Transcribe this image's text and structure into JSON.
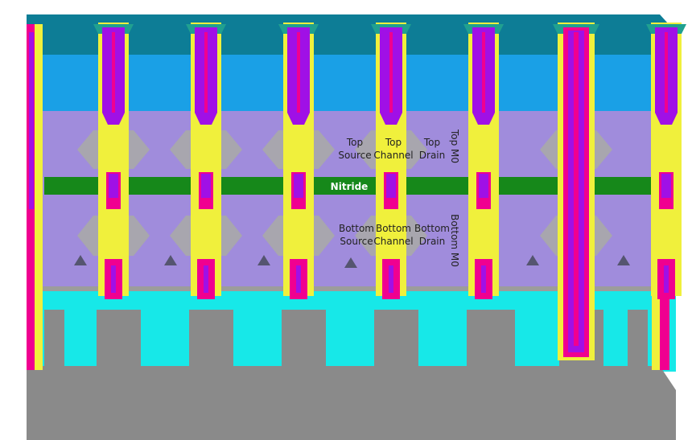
{
  "labels": {
    "top_source": [
      "Top",
      "Source"
    ],
    "top_channel": [
      "Top",
      "Channel"
    ],
    "top_drain": [
      "Top",
      "Drain"
    ],
    "top_m0": "Top M0",
    "nitride": "Nitride",
    "bottom_source": [
      "Bottom",
      "Source"
    ],
    "bottom_channel": [
      "Bottom",
      "Channel"
    ],
    "bottom_drain": [
      "Bottom",
      "Drain"
    ],
    "bottom_m0": "Bottom M0"
  },
  "colors": {
    "substrate": "#8a8a8a",
    "top_oxide_top": "#0d7d96",
    "top_oxide": "#1aa0e6",
    "cyan_fill": "#17e8e8",
    "liner": "#f0f03c",
    "dielectric": "#a08cdc",
    "grey_block": "#a8a8a8",
    "nitride": "#16881a",
    "via_purple": "#a010e6",
    "magenta": "#f00090",
    "teal_cap": "#20a090"
  },
  "gate_count": 7,
  "deep_via_gates": [
    5
  ]
}
